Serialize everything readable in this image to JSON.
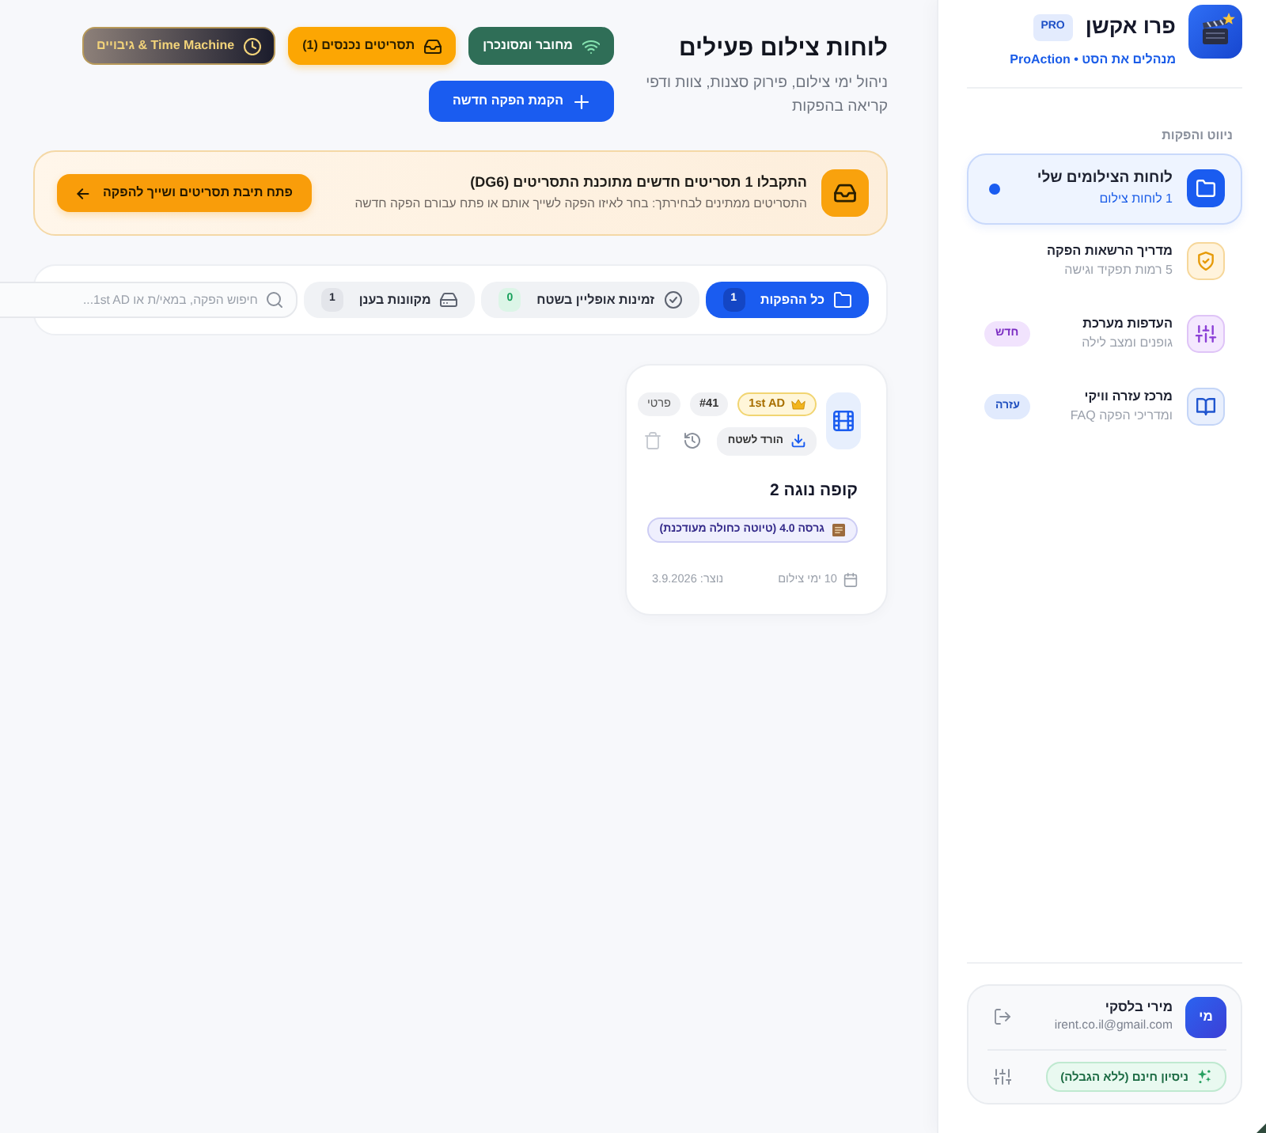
{
  "sidebar": {
    "brand": {
      "name": "פרו אקשן",
      "badge": "PRO",
      "tagline": "מנהלים את הסט • ProAction"
    },
    "section_label": "ניווט והפקות",
    "items": [
      {
        "kind": "boards",
        "title": "לוחות הצילומים שלי",
        "subtitle": "1 לוחות צילום",
        "selected": true
      },
      {
        "kind": "permissions",
        "title": "מדריך הרשאות הפקה",
        "subtitle": "5 רמות תפקיד וגישה",
        "selected": false
      },
      {
        "kind": "settings",
        "title": "העדפות מערכת",
        "subtitle": "גופנים ומצב לילה",
        "selected": false,
        "badge": "חדש"
      },
      {
        "kind": "help",
        "title": "מרכז עזרה וויקי",
        "subtitle": "FAQ ומדריכי הפקה",
        "selected": false,
        "badge": "עזרה"
      }
    ],
    "user": {
      "initials": "מי",
      "name": "מירי בלסקי",
      "email": "irent.co.il@gmail.com",
      "plan": "ניסיון חינם (ללא הגבלה)"
    }
  },
  "header": {
    "title": "לוחות צילום פעילים",
    "subtitle": "ניהול ימי צילום, פירוק סצנות, צוות ודפי קריאה בהפקות",
    "buttons": [
      {
        "kind": "status",
        "label": "מחובר ומסונכרן"
      },
      {
        "kind": "inbox",
        "label": "תסריטים נכנסים (1)"
      },
      {
        "kind": "backups",
        "label": "Time Machine & גיבויים"
      },
      {
        "kind": "create",
        "label": "הקמת הפקה חדשה"
      }
    ]
  },
  "banner": {
    "title": "התקבלו 1 תסריטים חדשים מתוכנת התסריטים (DG6)",
    "text": "התסריטים ממתינים לבחירתך: בחר לאיזו הפקה לשייך אותם או פתח עבורם הפקה חדשה",
    "button": "פתח תיבת תסריטים ושייך להפקה"
  },
  "filters": {
    "tabs": [
      {
        "kind": "all",
        "label": "כל ההפקות",
        "count": "1",
        "selected": true
      },
      {
        "kind": "offline",
        "label": "זמינות אופליין בשטח",
        "count": "0",
        "selected": false
      },
      {
        "kind": "cloud",
        "label": "מקוונות בענן",
        "count": "1",
        "selected": false
      }
    ],
    "search": {
      "placeholder": "חיפוש הפקה, במאי/ת או 1st AD..."
    }
  },
  "productions": [
    {
      "role": "1st AD",
      "number": "#41",
      "visibility": "פרטי",
      "download": "הורד לשטח",
      "title": "קופה נוגה 2",
      "version": "גרסה 4.0 (טיוטה כחולה מעודכנת)",
      "shoot_days": "10 ימי צילום",
      "created": "נוצר: 3.9.2026"
    }
  ]
}
